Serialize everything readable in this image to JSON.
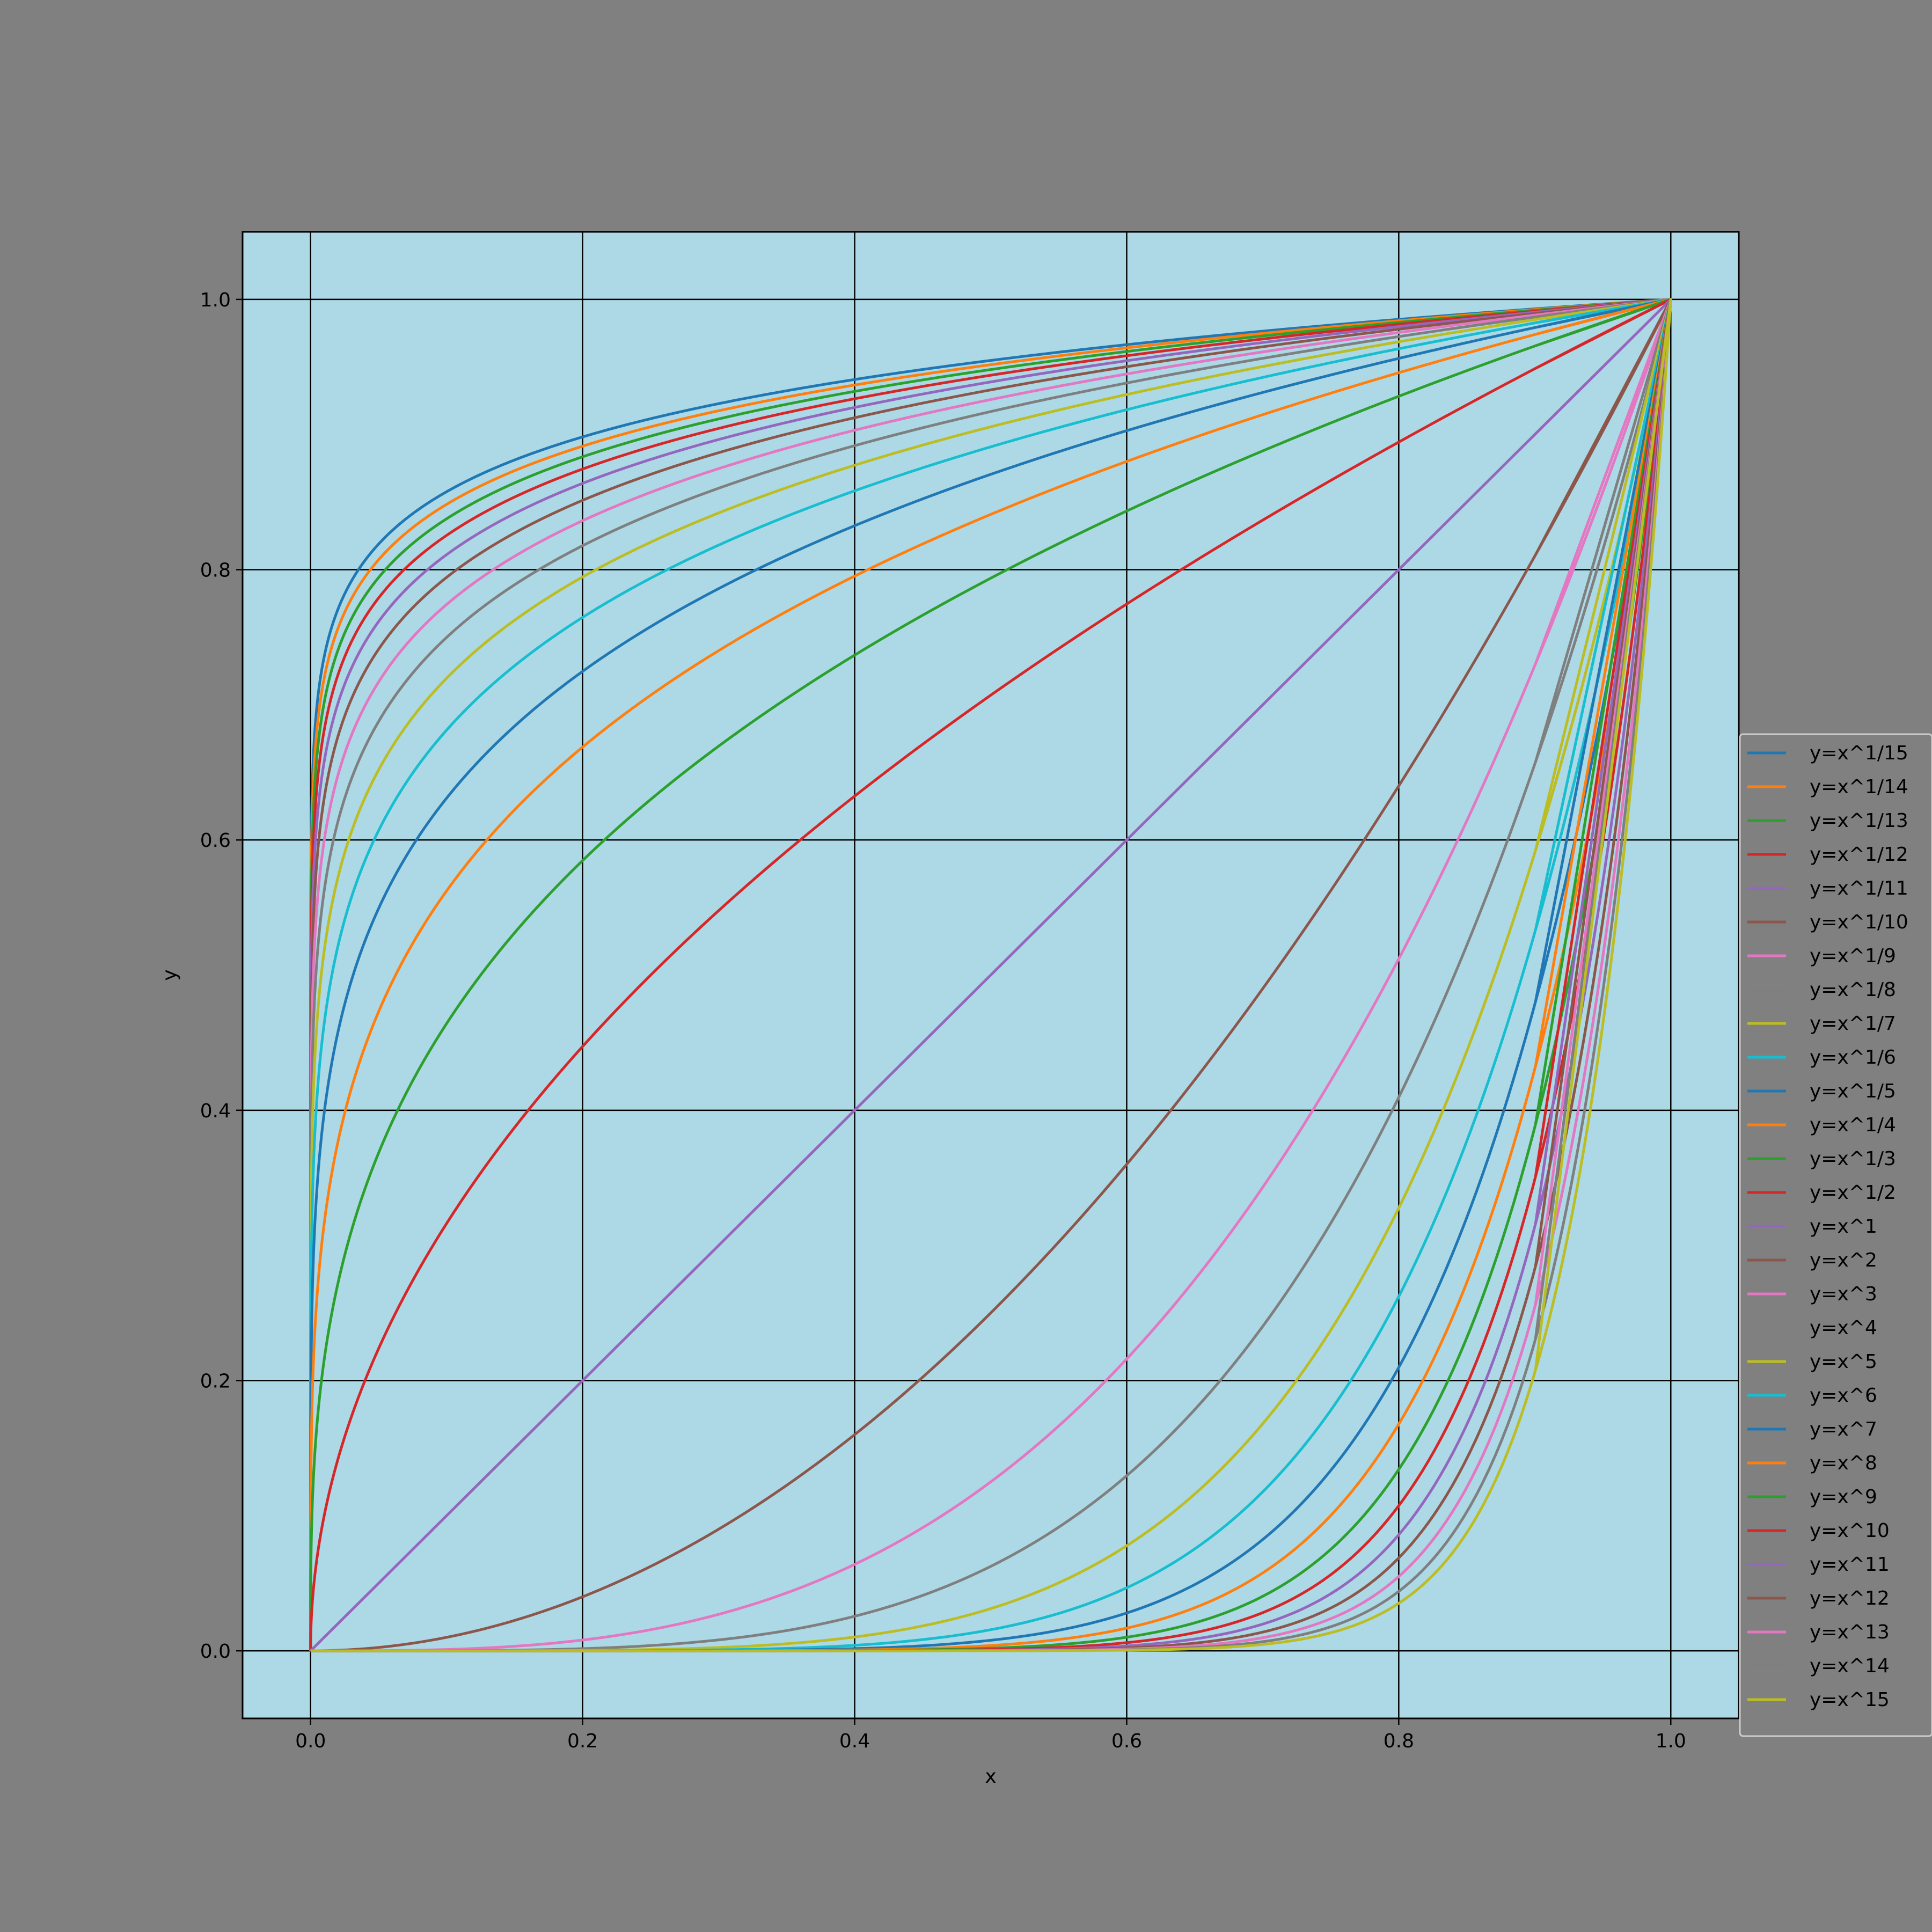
{
  "chart_data": {
    "type": "line",
    "title": "",
    "xlabel": "x",
    "ylabel": "y",
    "xlim": [
      -0.05,
      1.05
    ],
    "ylim": [
      -0.05,
      1.05
    ],
    "x_ticks": [
      "0.0",
      "0.2",
      "0.4",
      "0.6",
      "0.8",
      "1.0"
    ],
    "y_ticks": [
      "0.0",
      "0.2",
      "0.4",
      "0.6",
      "0.8",
      "1.0"
    ],
    "grid": true,
    "legend_placement": "right",
    "colors": {
      "figure_background": "#808080",
      "plot_background": "#add8e6",
      "grid": "#000000"
    },
    "series": [
      {
        "name": "y=x^1/15",
        "exponent": 0.0666667,
        "color": "#1f77b4"
      },
      {
        "name": "y=x^1/14",
        "exponent": 0.0714286,
        "color": "#ff7f0e"
      },
      {
        "name": "y=x^1/13",
        "exponent": 0.0769231,
        "color": "#2ca02c"
      },
      {
        "name": "y=x^1/12",
        "exponent": 0.0833333,
        "color": "#d62728"
      },
      {
        "name": "y=x^1/11",
        "exponent": 0.0909091,
        "color": "#9467bd"
      },
      {
        "name": "y=x^1/10",
        "exponent": 0.1,
        "color": "#8c564b"
      },
      {
        "name": "y=x^1/9",
        "exponent": 0.1111111,
        "color": "#e377c2"
      },
      {
        "name": "y=x^1/8",
        "exponent": 0.125,
        "color": "#7f7f7f"
      },
      {
        "name": "y=x^1/7",
        "exponent": 0.1428571,
        "color": "#bcbd22"
      },
      {
        "name": "y=x^1/6",
        "exponent": 0.1666667,
        "color": "#17becf"
      },
      {
        "name": "y=x^1/5",
        "exponent": 0.2,
        "color": "#1f77b4"
      },
      {
        "name": "y=x^1/4",
        "exponent": 0.25,
        "color": "#ff7f0e"
      },
      {
        "name": "y=x^1/3",
        "exponent": 0.3333333,
        "color": "#2ca02c"
      },
      {
        "name": "y=x^1/2",
        "exponent": 0.5,
        "color": "#d62728"
      },
      {
        "name": "y=x^1",
        "exponent": 1,
        "color": "#9467bd"
      },
      {
        "name": "y=x^2",
        "exponent": 2,
        "color": "#8c564b"
      },
      {
        "name": "y=x^3",
        "exponent": 3,
        "color": "#e377c2"
      },
      {
        "name": "y=x^4",
        "exponent": 4,
        "color": "#7f7f7f"
      },
      {
        "name": "y=x^5",
        "exponent": 5,
        "color": "#bcbd22"
      },
      {
        "name": "y=x^6",
        "exponent": 6,
        "color": "#17becf"
      },
      {
        "name": "y=x^7",
        "exponent": 7,
        "color": "#1f77b4"
      },
      {
        "name": "y=x^8",
        "exponent": 8,
        "color": "#ff7f0e"
      },
      {
        "name": "y=x^9",
        "exponent": 9,
        "color": "#2ca02c"
      },
      {
        "name": "y=x^10",
        "exponent": 10,
        "color": "#d62728"
      },
      {
        "name": "y=x^11",
        "exponent": 11,
        "color": "#9467bd"
      },
      {
        "name": "y=x^12",
        "exponent": 12,
        "color": "#8c564b"
      },
      {
        "name": "y=x^13",
        "exponent": 13,
        "color": "#e377c2"
      },
      {
        "name": "y=x^14",
        "exponent": 14,
        "color": "#7f7f7f"
      },
      {
        "name": "y=x^15",
        "exponent": 15,
        "color": "#bcbd22"
      }
    ]
  }
}
